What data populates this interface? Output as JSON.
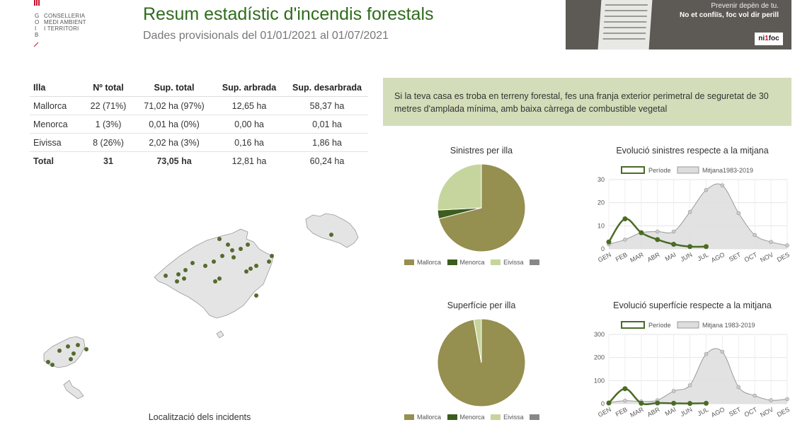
{
  "header": {
    "logo_letters": [
      "G",
      "O",
      "I",
      "B"
    ],
    "logo_lines": [
      "CONSELLERIA",
      "MEDI AMBIENT",
      "I TERRITORI"
    ],
    "title": "Resum estadístic d'incendis forestals",
    "subtitle": "Dades provisionals del 01/01/2021 al 01/07/2021"
  },
  "banner": {
    "line1": "Prevenir depèn de tu.",
    "line2": "No et confiïs, foc vol dir perill",
    "badge_a": "ni",
    "badge_b": "1",
    "badge_c": "foc"
  },
  "table": {
    "headers": [
      "Illa",
      "Nº total",
      "Sup. total",
      "Sup. arbrada",
      "Sup. desarbrada"
    ],
    "rows": [
      [
        "Mallorca",
        "22 (71%)",
        "71,02 ha (97%)",
        "12,65 ha",
        "58,37 ha"
      ],
      [
        "Menorca",
        "1 (3%)",
        "0,01 ha (0%)",
        "0,00 ha",
        "0,01 ha"
      ],
      [
        "Eivissa",
        "8 (26%)",
        "2,02 ha (3%)",
        "0,16 ha",
        "1,86 ha"
      ],
      [
        "Total",
        "31",
        "73,05 ha",
        "12,81 ha",
        "60,24 ha"
      ]
    ]
  },
  "notice": {
    "text": "Si la teva casa es troba en terreny forestal, fes una franja exterior perimetral de seguretat de 30 metres d'amplada mínima, amb baixa càrrega de combustible vegetal"
  },
  "map": {
    "caption": "Localització dels incidents",
    "point_color": "#556b2f"
  },
  "colors": {
    "mallorca": "#958f50",
    "menorca": "#3d5c1e",
    "eivissa": "#c5d59d",
    "other": "#888888",
    "period_line": "#4a6b25",
    "average_fill": "#dddddd",
    "average_line": "#999999"
  },
  "chart_data": [
    {
      "type": "pie",
      "title": "Sinistres per illa",
      "labels": [
        "Mallorca",
        "Menorca",
        "Eivissa",
        ""
      ],
      "values": [
        22,
        1,
        8,
        0
      ]
    },
    {
      "type": "pie",
      "title": "Superfície per illa",
      "labels": [
        "Mallorca",
        "Menorca",
        "Eivissa",
        ""
      ],
      "values": [
        71.02,
        0.01,
        2.02,
        0
      ]
    },
    {
      "type": "area",
      "title": "Evolució sinistres respecte a la mitjana",
      "categories": [
        "GEN",
        "FEB",
        "MAR",
        "ABR",
        "MAI",
        "JUN",
        "JUL",
        "AGO",
        "SET",
        "OCT",
        "NOV",
        "DES"
      ],
      "ylim": [
        0,
        30
      ],
      "yticks": [
        0,
        10,
        20,
        30
      ],
      "series": [
        {
          "name": "Període",
          "values": [
            3,
            13,
            7,
            4,
            2,
            1,
            1,
            null,
            null,
            null,
            null,
            null
          ]
        },
        {
          "name": "Mitjana1983-2019",
          "values": [
            2,
            4,
            7,
            7.5,
            7.5,
            16,
            25.5,
            27.5,
            15.5,
            6,
            3,
            1.5
          ]
        }
      ]
    },
    {
      "type": "area",
      "title": "Evolució superfície respecte a la mitjana",
      "categories": [
        "GEN",
        "FEB",
        "MAR",
        "ABR",
        "MAI",
        "JUN",
        "JUL",
        "AGO",
        "SET",
        "OCT",
        "NOV",
        "DES"
      ],
      "ylim": [
        0,
        300
      ],
      "yticks": [
        0,
        100,
        200,
        300
      ],
      "series": [
        {
          "name": "Període",
          "values": [
            3,
            65,
            2,
            3,
            2,
            1,
            2,
            null,
            null,
            null,
            null,
            null
          ]
        },
        {
          "name": "Mitjana 1983-2019",
          "values": [
            5,
            13,
            10,
            15,
            55,
            80,
            215,
            225,
            72,
            35,
            15,
            20
          ]
        }
      ]
    }
  ]
}
